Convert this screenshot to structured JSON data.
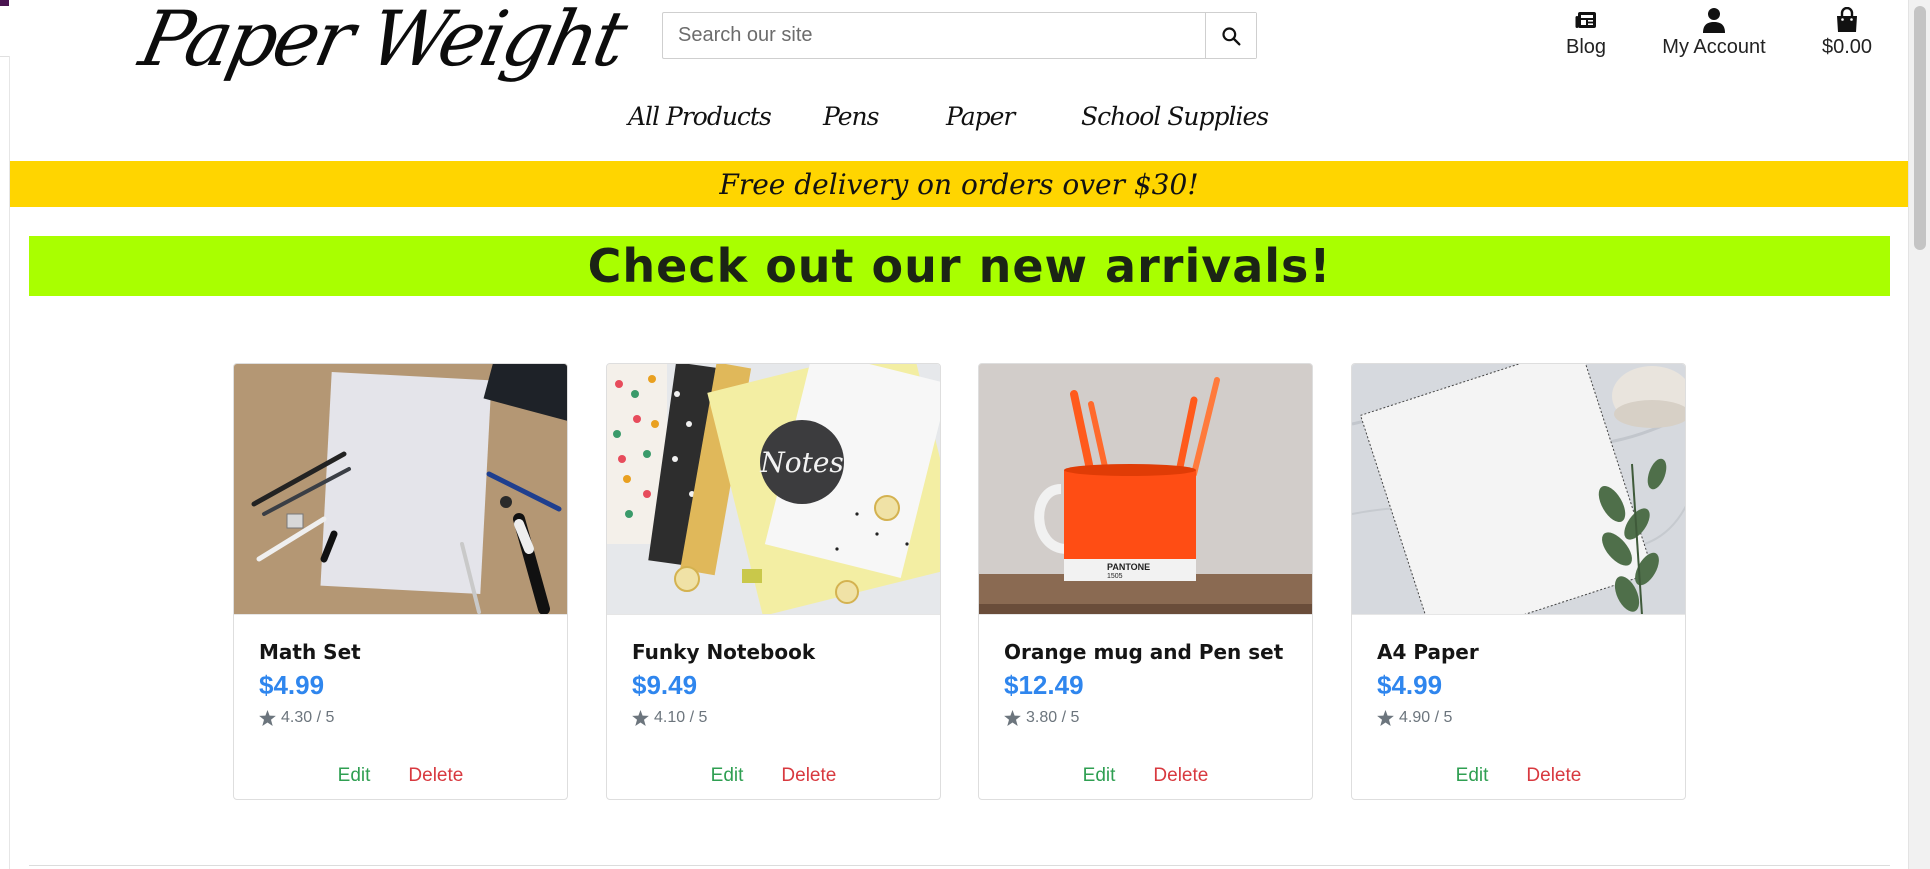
{
  "brand": {
    "logo_text": "Paper Weight"
  },
  "search": {
    "placeholder": "Search our site"
  },
  "header_links": [
    {
      "label": "Blog",
      "icon": "newspaper-icon"
    },
    {
      "label": "My Account",
      "icon": "user-icon"
    },
    {
      "label": "$0.00",
      "icon": "shopping-bag-icon"
    }
  ],
  "main_nav": [
    "All Products",
    "Pens",
    "Paper",
    "School Supplies"
  ],
  "promo": {
    "text": "Free delivery on orders over $30!"
  },
  "banner": {
    "text": "Check out our new arrivals!"
  },
  "products": [
    {
      "name": "Math Set",
      "price": "$4.99",
      "rating": "4.30 / 5",
      "edit_label": "Edit",
      "delete_label": "Delete"
    },
    {
      "name": "Funky Notebook",
      "price": "$9.49",
      "rating": "4.10 / 5",
      "edit_label": "Edit",
      "delete_label": "Delete"
    },
    {
      "name": "Orange mug and Pen set",
      "price": "$12.49",
      "rating": "3.80 / 5",
      "edit_label": "Edit",
      "delete_label": "Delete"
    },
    {
      "name": "A4 Paper",
      "price": "$4.99",
      "rating": "4.90 / 5",
      "edit_label": "Edit",
      "delete_label": "Delete"
    }
  ],
  "colors": {
    "promo_bar": "#ffd500",
    "banner": "#a9ff00",
    "price": "#2f86ee",
    "edit": "#2f9f52",
    "delete": "#d8393f"
  }
}
